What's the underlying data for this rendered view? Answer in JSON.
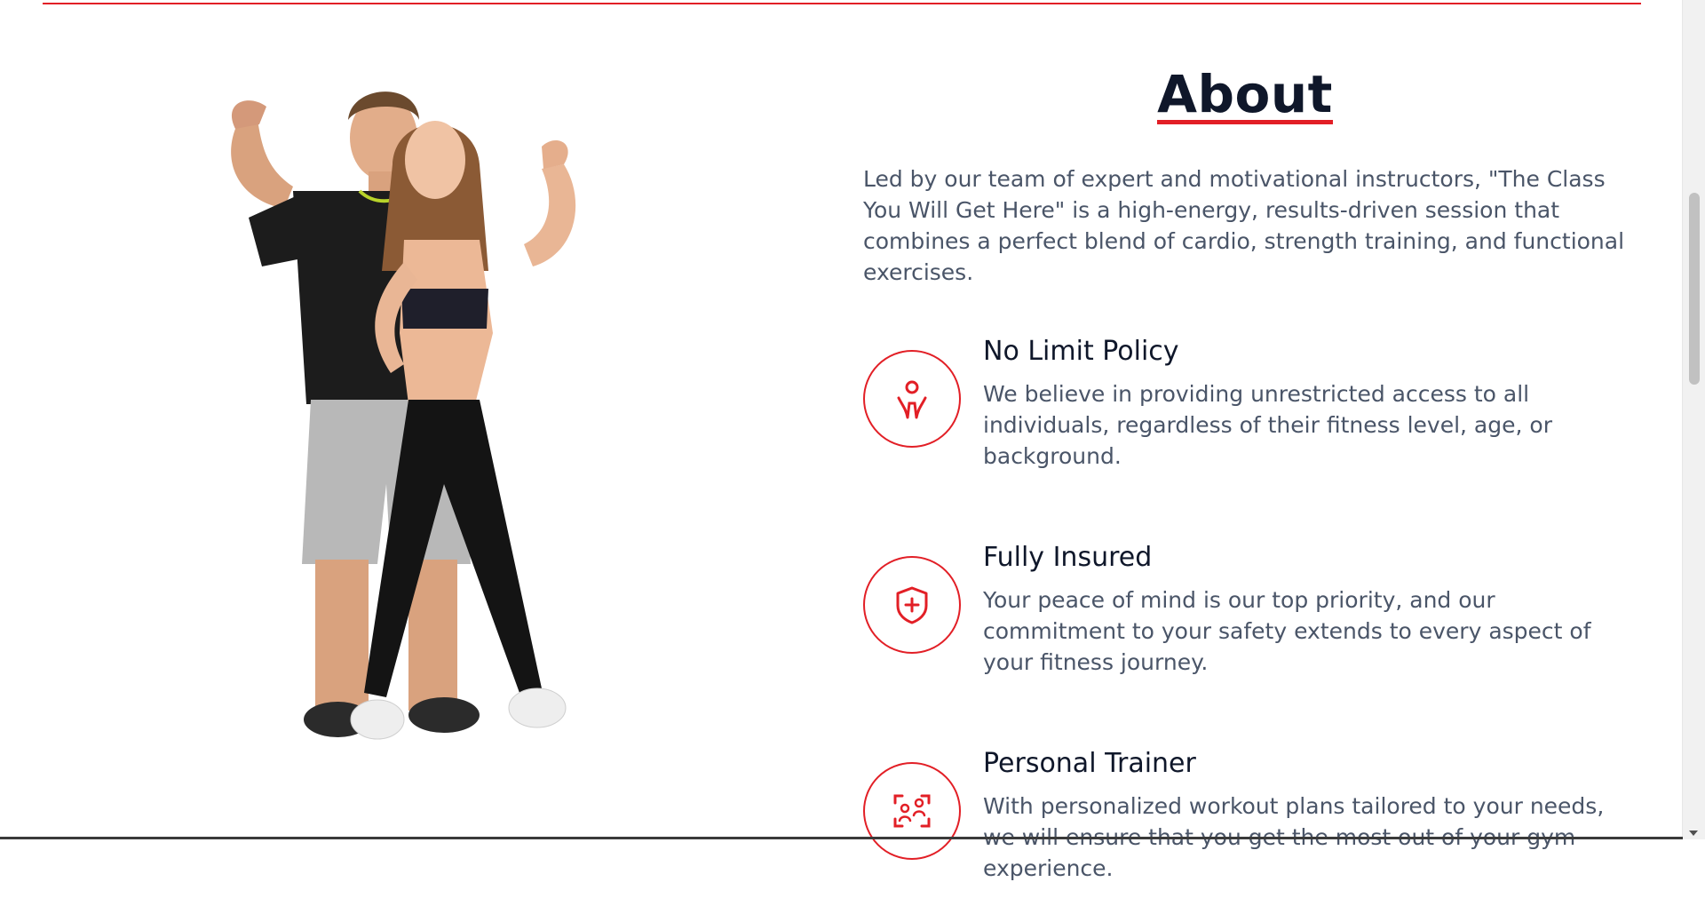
{
  "about": {
    "title": "About",
    "intro": "Led by our team of expert and motivational instructors, \"The Class You Will Get Here\" is a high-energy, results-driven session that combines a perfect blend of cardio, strength training, and functional exercises."
  },
  "features": [
    {
      "title": "No Limit Policy",
      "text": "We believe in providing unrestricted access to all individuals, regardless of their fitness level, age, or background.",
      "icon": "person-raised-arms-icon"
    },
    {
      "title": "Fully Insured",
      "text": "Your peace of mind is our top priority, and our commitment to your safety extends to every aspect of your fitness journey.",
      "icon": "shield-plus-icon"
    },
    {
      "title": "Personal Trainer",
      "text": "With personalized workout plans tailored to your needs, we will ensure that you get the most out of your gym experience.",
      "icon": "trainer-focus-icon"
    }
  ],
  "colors": {
    "accent": "#e21f26",
    "heading": "#0f172a",
    "body_text": "#4a5568"
  }
}
